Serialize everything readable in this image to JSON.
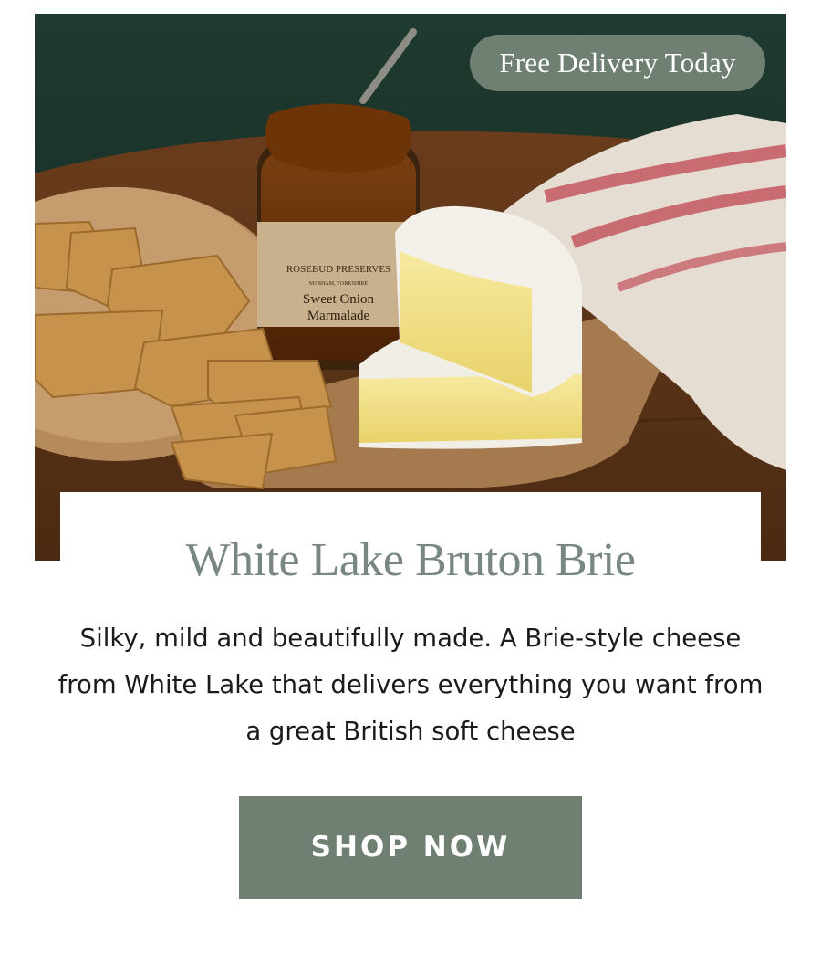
{
  "hero": {
    "image_alt": "Cheese board with crackers, a jar of sweet onion marmalade and two pieces of brie",
    "badge_label": "Free Delivery Today",
    "jar_label": {
      "brand": "ROSEBUD PRESERVES",
      "location": "MASHAM, YORKSHIRE",
      "product": "Sweet Onion",
      "product_line2": "Marmalade"
    }
  },
  "product": {
    "title": "White Lake Bruton Brie",
    "description": "Silky, mild and beautifully made. A Brie-style cheese from White Lake that delivers everything you want from a great British soft cheese"
  },
  "cta": {
    "label": "SHOP NOW"
  },
  "colors": {
    "accent_green": "#6f7f72",
    "title_green": "#788880",
    "text": "#1b1b1b"
  }
}
